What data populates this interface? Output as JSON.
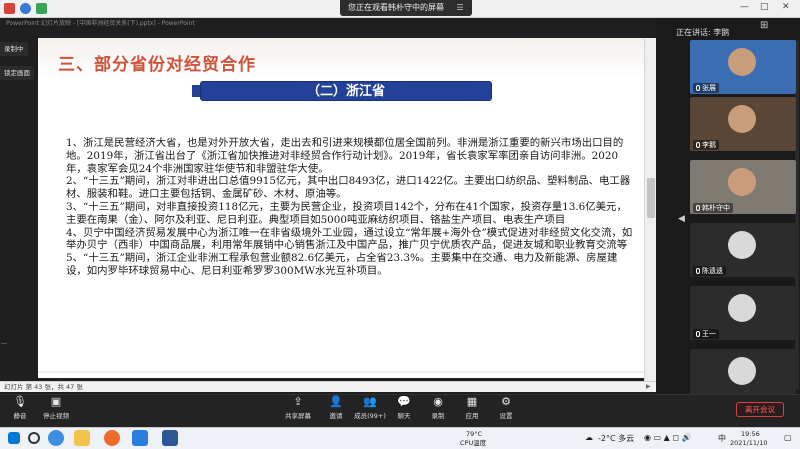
{
  "top_bar": {
    "share_banner": "您正在观看韩朴守中的屏幕",
    "close": "☰",
    "window_controls": [
      "—",
      "□",
      "✕"
    ],
    "ppt_window_title": "PowerPoint 幻灯片放映 - [中国非洲经贸关系(下).pptx] - PowerPoint"
  },
  "side_tools": {
    "record": "录制中",
    "lock": "锁定画面"
  },
  "slide": {
    "title": "三、部分省份对经贸合作",
    "subheading": "（二）浙江省",
    "paragraphs": [
      "1、浙江是民营经济大省，也是对外开放大省，走出去和引进来规模都位居全国前列。非洲是浙江重要的新兴市场出口目的地。2019年，浙江省出台了《浙江省加快推进对非经贸合作行动计划》。2019年，省长袁家军率团亲自访问非洲。2020年，袁家军会见24个非洲国家驻华使节和非盟驻华大使。",
      "2、“十三五”期间，浙江对非进出口总值9915亿元，其中出口8493亿，进口1422亿。主要出口纺织品、塑料制品、电工器材、服装和鞋。进口主要包括铜、金属矿砂、木材、原油等。",
      "3、“十三五”期间，对非直接投资118亿元，主要为民营企业，投资项目142个，分布在41个国家，投资存量13.6亿美元，主要在南果（金）、阿尔及利亚、尼日利亚。典型项目如5000吨亚麻纺织项目、铬盐生产项目、电表生产项目",
      "4、贝宁中国经济贸易发展中心为浙江唯一在非省级境外工业园，通过设立“常年展+海外仓”模式促进对非经贸文化交流，如举办贝宁（西非）中国商品展，利用常年展销中心销售浙江及中国产品，推广贝宁优质农产品，促进友城和职业教育交流等",
      "5、“十三五”期间，浙江企业非洲工程承包营业额82.6亿美元，占全省23.3%。主要集中在交通、电力及新能源、房屋建设，如内罗毕环球贸易中心、尼日利亚希罗罗300MW水光互补项目。"
    ],
    "corner_label": "—"
  },
  "status_bar": {
    "slide_counter": "幻灯片 第 43 张，共 47 张"
  },
  "right_panel": {
    "speaking": "正在讲话: 李鹅",
    "participants": [
      {
        "name": "张展",
        "bg": "#3b6db3"
      },
      {
        "name": "李鹅",
        "bg": "#5a4636"
      },
      {
        "name": "韩朴守中",
        "bg": "#7e7a72"
      },
      {
        "name": "陈遗遗",
        "bg": "#2c2c2c"
      },
      {
        "name": "王一",
        "bg": "#2c2c2c"
      },
      {
        "name": "",
        "bg": "#2c2c2c"
      }
    ]
  },
  "meeting_bar": {
    "mute": "静音",
    "stop_video": "停止视频",
    "share": "共享屏幕",
    "invite": "邀请",
    "members": "成员(99+)",
    "chat": "聊天",
    "record": "录制",
    "apps": "应用",
    "settings": "设置",
    "leave": "离开会议"
  },
  "taskbar": {
    "weather_temp": "79°C",
    "weather_label": "CPU温度",
    "temp_outdoor": "-2°C 多云",
    "ime": "中",
    "time": "19:56",
    "date": "2021/11/10"
  },
  "colors": {
    "title_red": "#d05238",
    "subhead_blue": "#24419a",
    "leave_red": "#ff5a5a"
  }
}
